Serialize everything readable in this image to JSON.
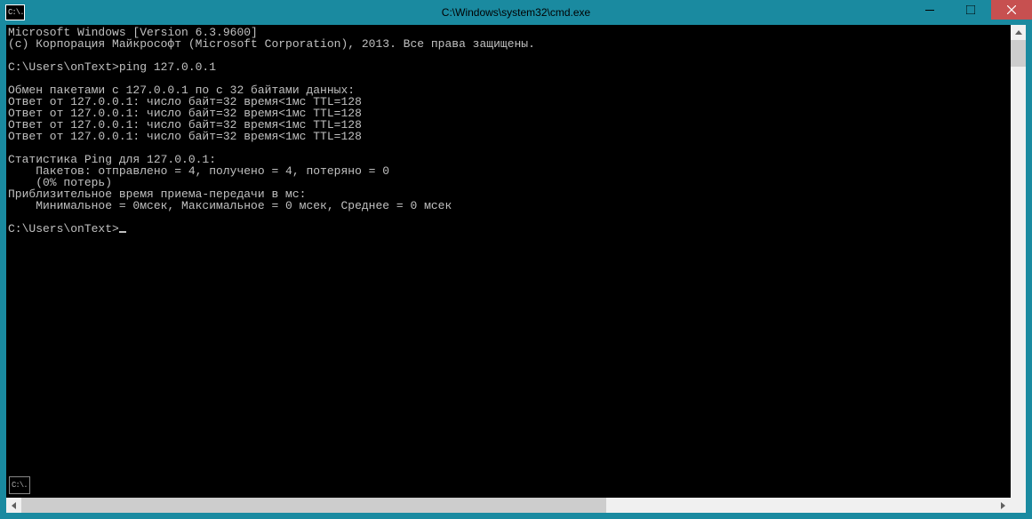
{
  "window": {
    "title": "C:\\Windows\\system32\\cmd.exe",
    "app_icon_label": "C:\\."
  },
  "console": {
    "lines": [
      "Microsoft Windows [Version 6.3.9600]",
      "(c) Корпорация Майкрософт (Microsoft Corporation), 2013. Все права защищены.",
      "",
      "C:\\Users\\onText>ping 127.0.0.1",
      "",
      "Обмен пакетами с 127.0.0.1 по с 32 байтами данных:",
      "Ответ от 127.0.0.1: число байт=32 время<1мс TTL=128",
      "Ответ от 127.0.0.1: число байт=32 время<1мс TTL=128",
      "Ответ от 127.0.0.1: число байт=32 время<1мс TTL=128",
      "Ответ от 127.0.0.1: число байт=32 время<1мс TTL=128",
      "",
      "Статистика Ping для 127.0.0.1:",
      "    Пакетов: отправлено = 4, получено = 4, потеряно = 0",
      "    (0% потерь)",
      "Приблизительное время приема-передачи в мс:",
      "    Минимальное = 0мсек, Максимальное = 0 мсек, Среднее = 0 мсек",
      "",
      "C:\\Users\\onText>"
    ],
    "prompt_cursor": true
  },
  "sys_icon_label": "C:\\."
}
